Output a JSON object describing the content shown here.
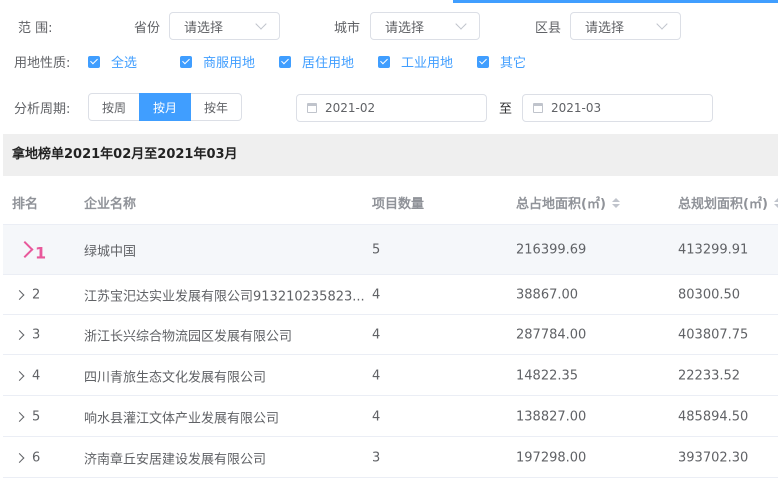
{
  "filters": {
    "range_label": "范 围:",
    "province_label": "省份",
    "province_placeholder": "请选择",
    "city_label": "城市",
    "city_placeholder": "请选择",
    "district_label": "区县",
    "district_placeholder": "请选择",
    "land_label": "用地性质:",
    "land_options": [
      "全选",
      "商服用地",
      "居住用地",
      "工业用地",
      "其它"
    ],
    "period_label": "分析周期:",
    "period_buttons": [
      "按周",
      "按月",
      "按年"
    ],
    "period_active": "按月",
    "date_from": "2021-02",
    "date_to_sep": "至",
    "date_to": "2021-03"
  },
  "section": {
    "title": "拿地榜单2021年02月至2021年03月"
  },
  "table": {
    "headers": [
      "排名",
      "企业名称",
      "项目数量",
      "总占地面积(㎡)",
      "总规划面积(㎡)"
    ],
    "rows": [
      {
        "rank": "1",
        "name": "绿城中国",
        "count": "5",
        "area": "216399.69",
        "plan": "413299.91"
      },
      {
        "rank": "2",
        "name": "江苏宝汜达实业发展有限公司913210235823...",
        "count": "4",
        "area": "38867.00",
        "plan": "80300.50"
      },
      {
        "rank": "3",
        "name": "浙江长兴综合物流园区发展有限公司",
        "count": "4",
        "area": "287784.00",
        "plan": "403807.75"
      },
      {
        "rank": "4",
        "name": "四川青旅生态文化发展有限公司",
        "count": "4",
        "area": "14822.35",
        "plan": "22233.52"
      },
      {
        "rank": "5",
        "name": "响水县灌江文体产业发展有限公司",
        "count": "4",
        "area": "138827.00",
        "plan": "485894.50"
      },
      {
        "rank": "6",
        "name": "济南章丘安居建设发展有限公司",
        "count": "3",
        "area": "197298.00",
        "plan": "393702.30"
      }
    ]
  },
  "colors": {
    "accent": "#409eff",
    "rank_top": "#e8589b",
    "section_bg": "#efefef"
  }
}
